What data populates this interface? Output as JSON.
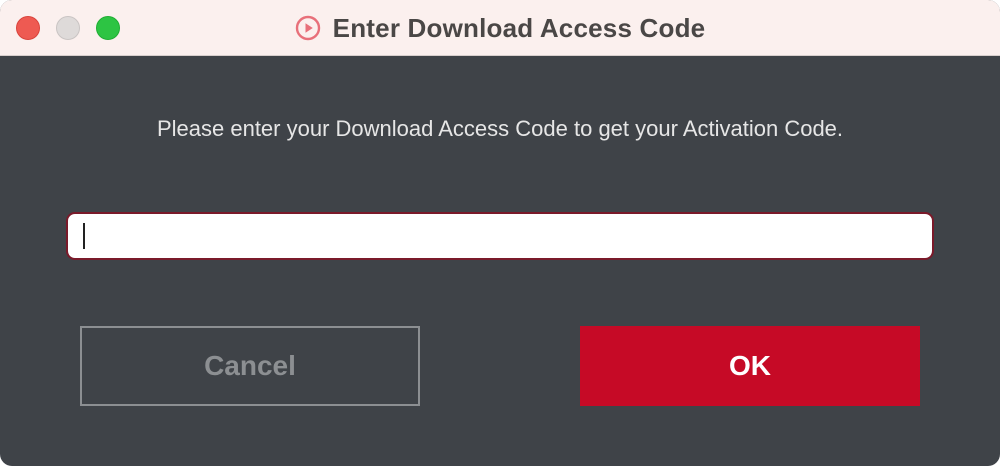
{
  "window": {
    "title": "Enter Download Access Code",
    "title_icon": "play-circle-icon"
  },
  "dialog": {
    "prompt": "Please enter your Download Access Code to get your Activation Code.",
    "input_value": "",
    "input_placeholder": ""
  },
  "buttons": {
    "cancel_label": "Cancel",
    "ok_label": "OK"
  },
  "colors": {
    "accent": "#c60a26",
    "background": "#3f4348",
    "titlebar": "#fbf0ee",
    "input_border": "#7a1a2a"
  }
}
